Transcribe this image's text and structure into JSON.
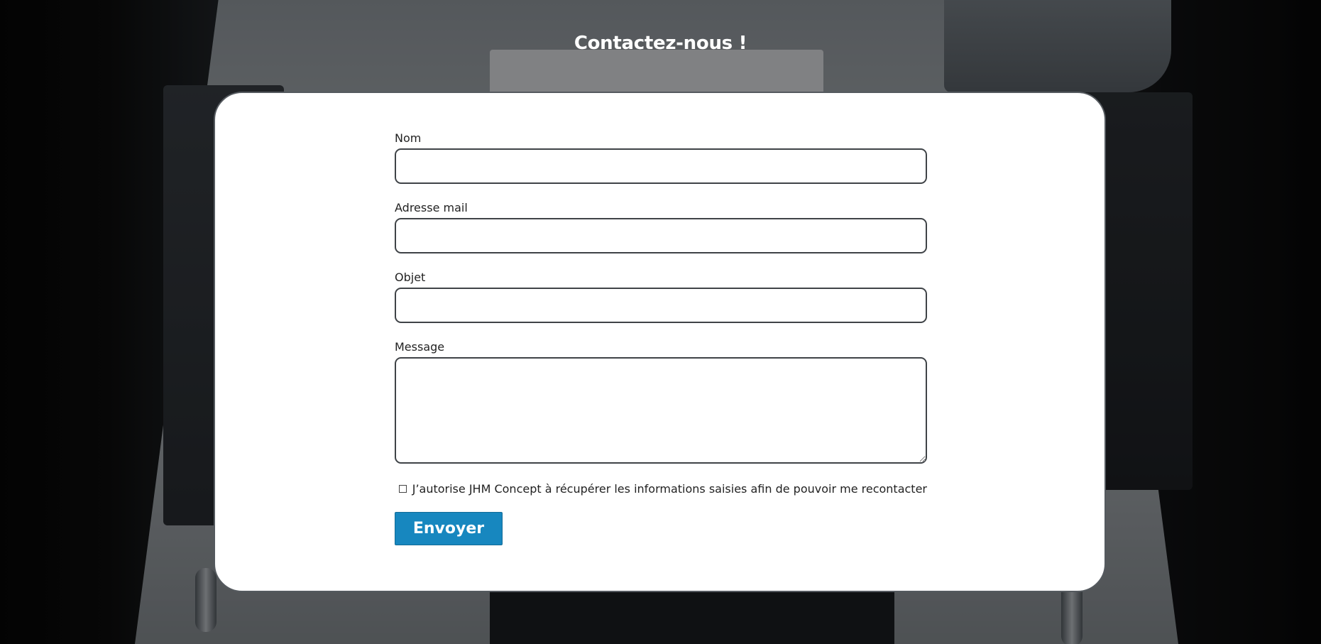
{
  "page": {
    "heading": "Contactez-nous !"
  },
  "form": {
    "fields": {
      "name": {
        "label": "Nom",
        "value": "",
        "placeholder": ""
      },
      "email": {
        "label": "Adresse mail",
        "value": "",
        "placeholder": ""
      },
      "subject": {
        "label": "Objet",
        "value": "",
        "placeholder": ""
      },
      "message": {
        "label": "Message",
        "value": "",
        "placeholder": ""
      }
    },
    "consent": {
      "checked": false,
      "label": "J’autorise JHM Concept à récupérer les informations saisies afin de pouvoir me recontacter"
    },
    "submit_label": "Envoyer"
  },
  "colors": {
    "button": "#1787bf",
    "card_border": "#555a5f",
    "heading_text": "#ffffff"
  }
}
